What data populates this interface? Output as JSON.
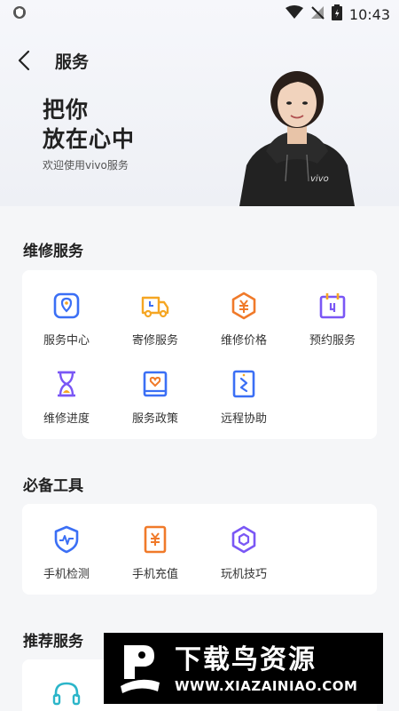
{
  "status_bar": {
    "time": "10:43"
  },
  "nav": {
    "title": "服务"
  },
  "hero": {
    "line1": "把你",
    "line2": "放在心中",
    "subtitle": "欢迎使用vivo服务"
  },
  "sections": {
    "repair": {
      "title": "维修服务",
      "items": [
        {
          "label": "服务中心",
          "icon": "service-center-icon",
          "color": "#3b6ff5"
        },
        {
          "label": "寄修服务",
          "icon": "truck-icon",
          "color": "#f5a623"
        },
        {
          "label": "维修价格",
          "icon": "price-hexagon-icon",
          "color": "#f07a2a"
        },
        {
          "label": "预约服务",
          "icon": "calendar-icon",
          "color": "#7a57f5"
        },
        {
          "label": "维修进度",
          "icon": "hourglass-icon",
          "color": "#7a57f5"
        },
        {
          "label": "服务政策",
          "icon": "policy-book-icon",
          "color": "#3b6ff5"
        },
        {
          "label": "远程协助",
          "icon": "remote-assist-icon",
          "color": "#3b6ff5"
        }
      ]
    },
    "tools": {
      "title": "必备工具",
      "items": [
        {
          "label": "手机检测",
          "icon": "shield-pulse-icon",
          "color": "#3b6ff5"
        },
        {
          "label": "手机充值",
          "icon": "recharge-icon",
          "color": "#f07a2a"
        },
        {
          "label": "玩机技巧",
          "icon": "tips-hexagon-icon",
          "color": "#7a57f5"
        }
      ]
    },
    "recommend": {
      "title": "推荐服务"
    }
  },
  "watermark": {
    "title": "下载鸟资源",
    "url": "WWW.XIAZAINIAO.COM"
  },
  "person_logo": "vivo"
}
